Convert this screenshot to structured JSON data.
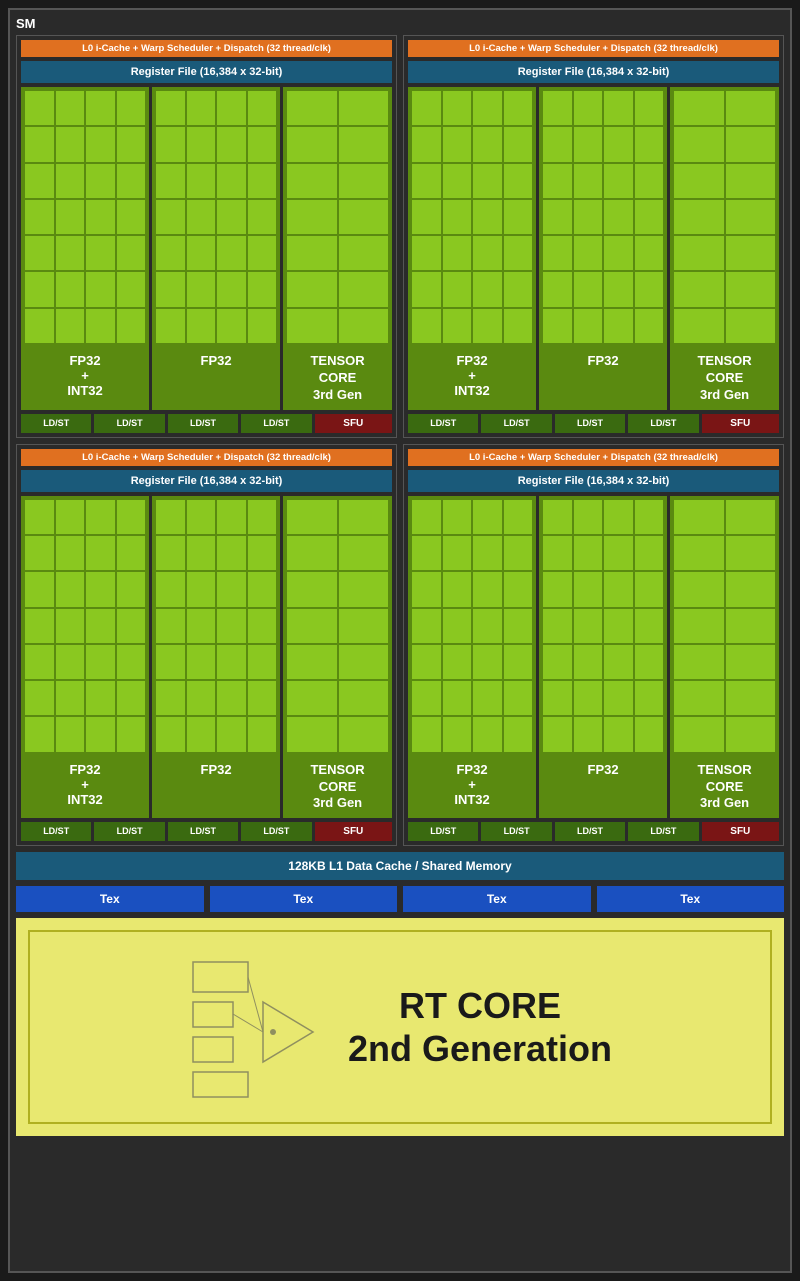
{
  "sm": {
    "label": "SM",
    "warp_scheduler": "L0 i-Cache + Warp Scheduler + Dispatch (32 thread/clk)",
    "register_file": "Register File (16,384 x 32-bit)",
    "fp32_int32_label": "FP32\n+\nINT32",
    "fp32_label": "FP32",
    "tensor_core_label": "TENSOR\nCORE\n3rd Gen",
    "ldst_label": "LD/ST",
    "sfu_label": "SFU",
    "l1_cache": "128KB L1 Data Cache / Shared Memory",
    "tex_label": "Tex",
    "rt_core_title": "RT CORE",
    "rt_core_subtitle": "2nd Generation",
    "quadrant_count": 4,
    "tex_count": 4
  },
  "colors": {
    "bg": "#2a2a2a",
    "warp_bar": "#e07020",
    "register_bar": "#1a5a7a",
    "green_dark": "#5a8a10",
    "green_cell": "#8ac820",
    "ldst_bg": "#3a6a10",
    "sfu_bg": "#7a1515",
    "tex_bg": "#1a50c0",
    "rt_core_bg": "#e8e870",
    "rt_border": "#b0b020"
  }
}
